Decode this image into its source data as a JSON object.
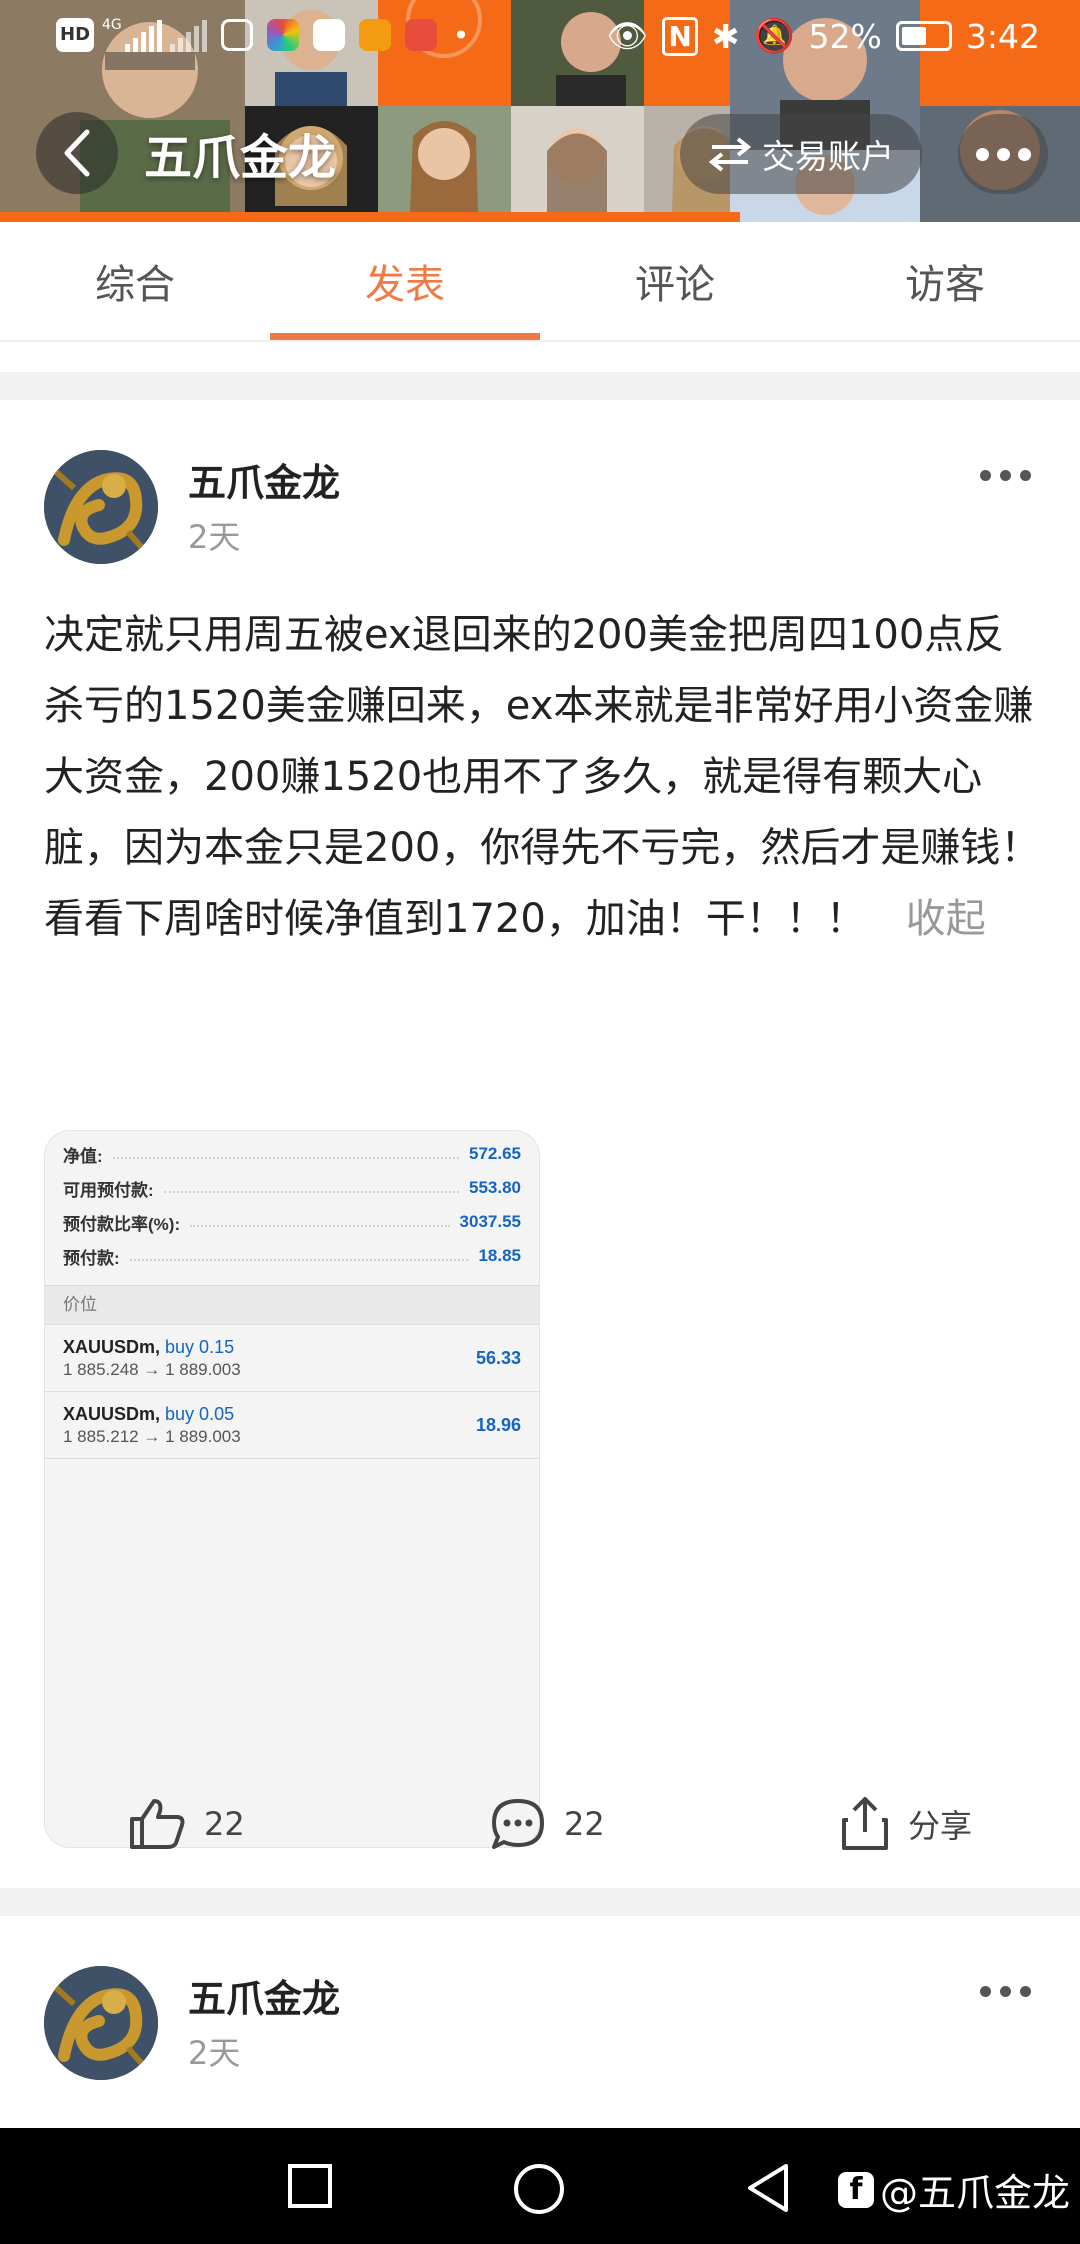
{
  "status_bar": {
    "hd": "HD",
    "net": "4G",
    "battery": "52%",
    "time": "3:42"
  },
  "header": {
    "title": "五爪金龙",
    "account_button": "交易账户"
  },
  "tabs": [
    {
      "label": "综合",
      "active": false
    },
    {
      "label": "发表",
      "active": true
    },
    {
      "label": "评论",
      "active": false
    },
    {
      "label": "访客",
      "active": false
    }
  ],
  "post1": {
    "author": "五爪金龙",
    "time": "2天",
    "text": "决定就只用周五被ex退回来的200美金把周四100点反杀亏的1520美金赚回来，ex本来就是非常好用小资金赚大资金，200赚1520也用不了多久，就是得有颗大心脏，因为本金只是200，你得先不亏完，然后才是赚钱！看看下周啥时候净值到1720，加油！干！！！",
    "fold_label": "收起",
    "screenshot": {
      "rows": [
        {
          "label": "净值:",
          "value": "572.65"
        },
        {
          "label": "可用预付款:",
          "value": "553.80"
        },
        {
          "label": "预付款比率(%):",
          "value": "3037.55"
        },
        {
          "label": "预付款:",
          "value": "18.85"
        }
      ],
      "section_header": "价位",
      "positions": [
        {
          "symbol": "XAUUSDm,",
          "side": "buy 0.15",
          "prices": "1 885.248 → 1 889.003",
          "profit": "56.33"
        },
        {
          "symbol": "XAUUSDm,",
          "side": "buy 0.05",
          "prices": "1 885.212 → 1 889.003",
          "profit": "18.96"
        }
      ]
    },
    "likes": "22",
    "comments": "22",
    "share_label": "分享"
  },
  "post2": {
    "author": "五爪金龙",
    "time": "2天"
  },
  "watermark": "@五爪金龙",
  "colors": {
    "accent": "#f07a45",
    "banner_orange": "#f56a16",
    "value_blue": "#1565c0"
  }
}
